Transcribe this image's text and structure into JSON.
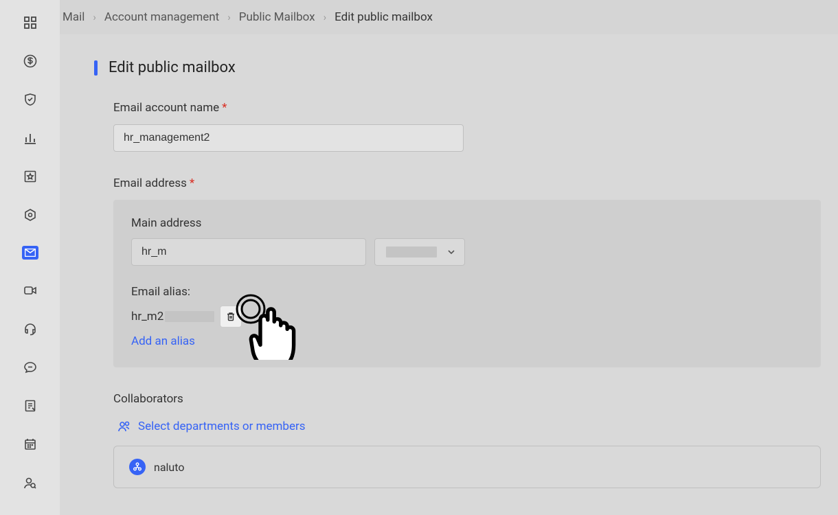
{
  "breadcrumbs": {
    "items": [
      "Mail",
      "Account management",
      "Public Mailbox",
      "Edit public mailbox"
    ]
  },
  "page": {
    "title": "Edit public mailbox"
  },
  "form": {
    "account_name_label": "Email account name",
    "account_name_value": "hr_management2",
    "email_address_label": "Email address",
    "main_address_label": "Main address",
    "main_address_value": "hr_m",
    "alias_label": "Email alias:",
    "alias_value": "hr_m2",
    "add_alias_label": "Add an alias",
    "collaborators_label": "Collaborators",
    "select_members_label": "Select departments or members",
    "collaborator_name": "naluto"
  },
  "sidebar": {
    "icons": [
      "grid",
      "dollar",
      "shield",
      "bar-chart",
      "star-box",
      "hexagon",
      "mail",
      "video",
      "headset",
      "chat",
      "document",
      "calendar",
      "user-search"
    ]
  }
}
